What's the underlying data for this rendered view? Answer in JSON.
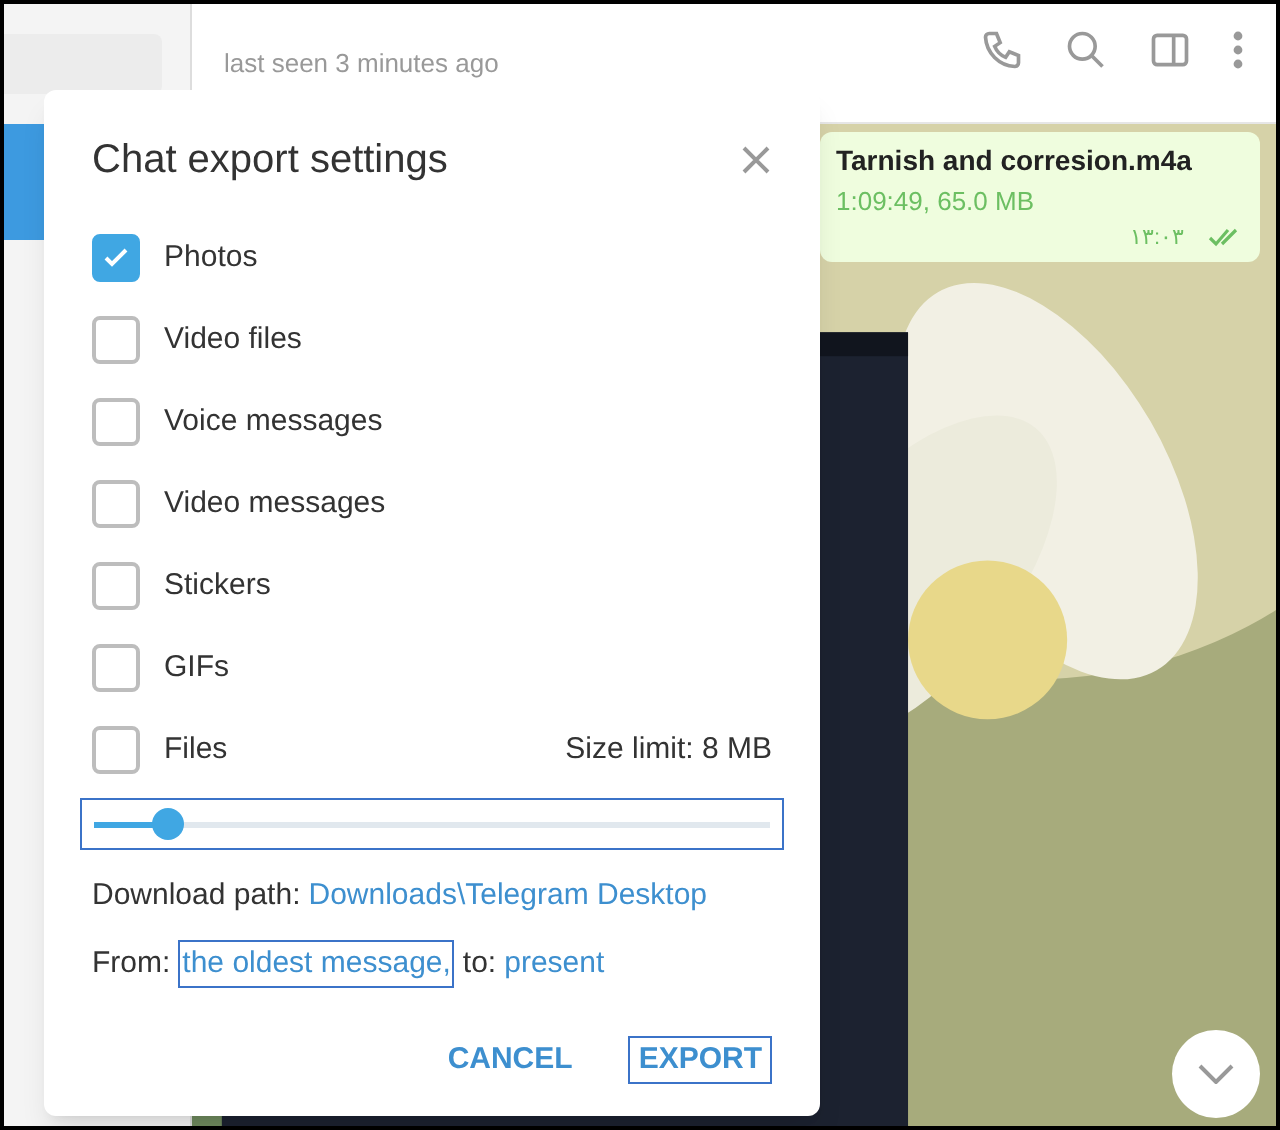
{
  "header": {
    "status": "last seen 3 minutes ago"
  },
  "message": {
    "file_name": "Tarnish and corresion.m4a",
    "meta": "1:09:49, 65.0 MB",
    "time": "١٣:٠٣",
    "read": true
  },
  "dialog": {
    "title": "Chat export settings",
    "options": [
      {
        "label": "Photos",
        "checked": true
      },
      {
        "label": "Video files",
        "checked": false
      },
      {
        "label": "Voice messages",
        "checked": false
      },
      {
        "label": "Video messages",
        "checked": false
      },
      {
        "label": "Stickers",
        "checked": false
      },
      {
        "label": "GIFs",
        "checked": false
      },
      {
        "label": "Files",
        "checked": false
      }
    ],
    "size_limit": "Size limit: 8 MB",
    "slider": {
      "level": 0.11
    },
    "download_path": {
      "label": "Download path:",
      "value": "Downloads\\Telegram Desktop"
    },
    "range": {
      "from_label": "From:",
      "from": "the oldest message,",
      "to_label": "to:",
      "to": "present"
    },
    "buttons": [
      "CANCEL",
      "EXPORT"
    ]
  }
}
